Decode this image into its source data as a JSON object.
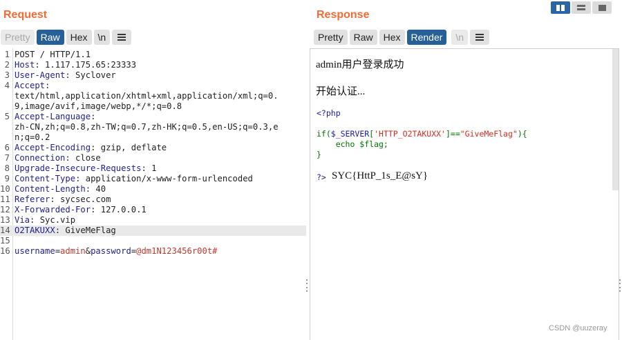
{
  "request": {
    "title": "Request",
    "tabs": [
      "Pretty",
      "Raw",
      "Hex",
      "\\n"
    ],
    "active_tab": "Raw",
    "lines": [
      {
        "num": "1",
        "parts": [
          {
            "t": "POST / HTTP/1.1",
            "c": "txt"
          }
        ]
      },
      {
        "num": "2",
        "parts": [
          {
            "t": "Host",
            "c": "hkey"
          },
          {
            "t": ": 1.117.175.65:23333",
            "c": "hval"
          }
        ]
      },
      {
        "num": "3",
        "parts": [
          {
            "t": "User-Agent",
            "c": "hkey"
          },
          {
            "t": ": Syclover",
            "c": "hval"
          }
        ]
      },
      {
        "num": "4",
        "parts": [
          {
            "t": "Accept",
            "c": "hkey"
          },
          {
            "t": ":",
            "c": "hval"
          }
        ]
      },
      {
        "num": "",
        "parts": [
          {
            "t": "text/html,application/xhtml+xml,application/xml;q=0.",
            "c": "hval"
          }
        ]
      },
      {
        "num": "",
        "parts": [
          {
            "t": "9,image/avif,image/webp,*/*;q=0.8",
            "c": "hval"
          }
        ]
      },
      {
        "num": "5",
        "parts": [
          {
            "t": "Accept-Language",
            "c": "hkey"
          },
          {
            "t": ":",
            "c": "hval"
          }
        ]
      },
      {
        "num": "",
        "parts": [
          {
            "t": "zh-CN,zh;q=0.8,zh-TW;q=0.7,zh-HK;q=0.5,en-US;q=0.3,e",
            "c": "hval"
          }
        ]
      },
      {
        "num": "",
        "parts": [
          {
            "t": "n;q=0.2",
            "c": "hval"
          }
        ]
      },
      {
        "num": "6",
        "parts": [
          {
            "t": "Accept-Encoding",
            "c": "hkey"
          },
          {
            "t": ": gzip, deflate",
            "c": "hval"
          }
        ]
      },
      {
        "num": "7",
        "parts": [
          {
            "t": "Connection",
            "c": "hkey"
          },
          {
            "t": ": close",
            "c": "hval"
          }
        ]
      },
      {
        "num": "8",
        "parts": [
          {
            "t": "Upgrade-Insecure-Requests",
            "c": "hkey"
          },
          {
            "t": ": 1",
            "c": "hval"
          }
        ]
      },
      {
        "num": "9",
        "parts": [
          {
            "t": "Content-Type",
            "c": "hkey"
          },
          {
            "t": ": application/x-www-form-urlencoded",
            "c": "hval"
          }
        ]
      },
      {
        "num": "10",
        "parts": [
          {
            "t": "Content-Length",
            "c": "hkey"
          },
          {
            "t": ": 40",
            "c": "hval"
          }
        ]
      },
      {
        "num": "11",
        "parts": [
          {
            "t": "Referer",
            "c": "hkey"
          },
          {
            "t": ": sycsec.com",
            "c": "hval"
          }
        ]
      },
      {
        "num": "12",
        "parts": [
          {
            "t": "X-Forwarded-For",
            "c": "hkey"
          },
          {
            "t": ": 127.0.0.1",
            "c": "hval"
          }
        ]
      },
      {
        "num": "13",
        "parts": [
          {
            "t": "Via",
            "c": "hkey"
          },
          {
            "t": ": Syc.vip",
            "c": "hval"
          }
        ]
      },
      {
        "num": "14",
        "parts": [
          {
            "t": "O2TAKUXX",
            "c": "hkey"
          },
          {
            "t": ": GiveMeFlag",
            "c": "hval"
          }
        ],
        "highlight": true
      },
      {
        "num": "15",
        "parts": []
      },
      {
        "num": "16",
        "parts": [
          {
            "t": "username",
            "c": "pkey"
          },
          {
            "t": "=",
            "c": "hval"
          },
          {
            "t": "admin",
            "c": "pval"
          },
          {
            "t": "&",
            "c": "hval"
          },
          {
            "t": "password",
            "c": "pkey"
          },
          {
            "t": "=",
            "c": "hval"
          },
          {
            "t": "@dm1N123456r00t#",
            "c": "pval"
          }
        ]
      }
    ]
  },
  "response": {
    "title": "Response",
    "tabs": [
      "Pretty",
      "Raw",
      "Hex",
      "Render",
      "\\n"
    ],
    "active_tab": "Render",
    "disabled_tab": "\\n",
    "line1": "admin用户登录成功",
    "line2": "开始认证...",
    "php_open": "<?php",
    "php_if": "if($_SERVER['HTTP_O2TAKUXX']==\"GiveMeFlag\"){",
    "php_echo": "    echo $flag;",
    "php_close_brace": "}",
    "php_close": "?>",
    "flag": "SYC{HttP_1s_E@sY}"
  },
  "watermark": "CSDN @uuzeray",
  "colors": {
    "title": "#f26b34",
    "active_tab": "#275f99"
  },
  "icons": [
    "menu-icon",
    "layout-columns-icon",
    "layout-rows-icon",
    "layout-single-icon"
  ]
}
